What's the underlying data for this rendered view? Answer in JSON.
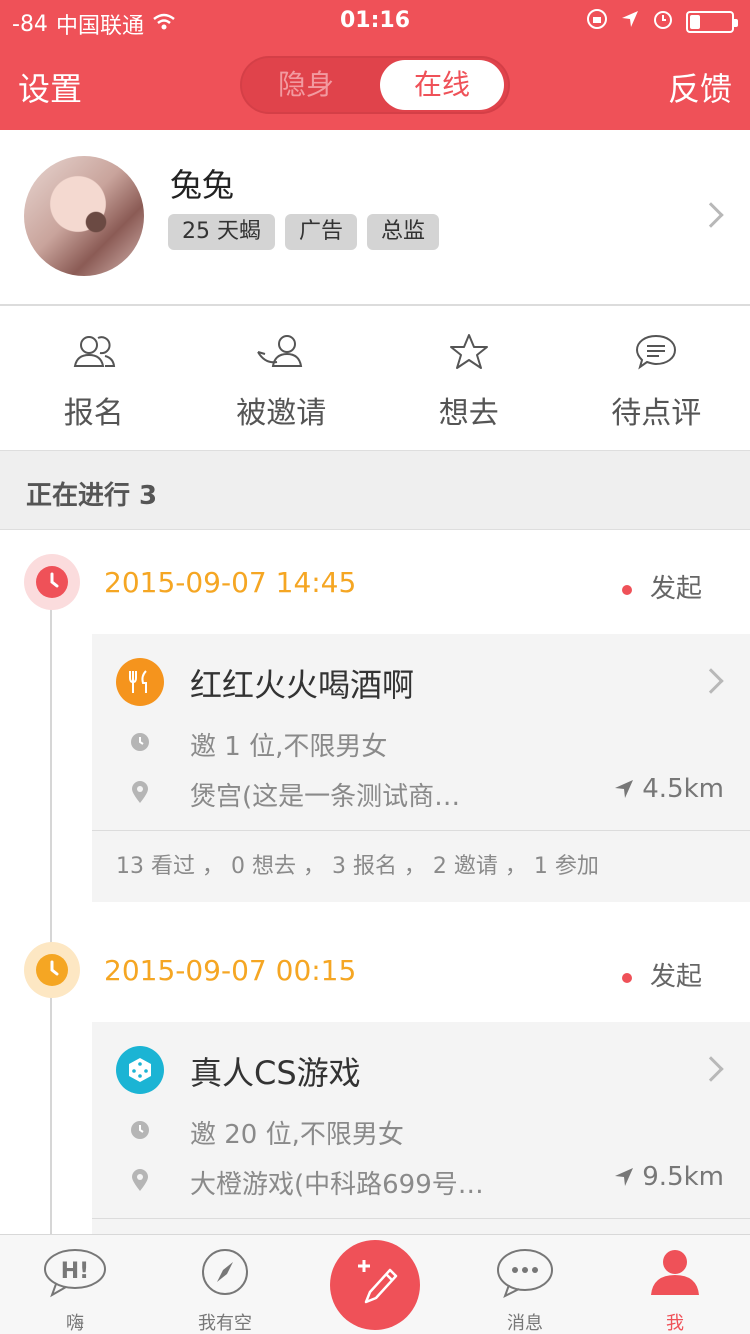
{
  "status_bar": {
    "signal": "-84",
    "carrier": "中国联通",
    "time": "01:16"
  },
  "header": {
    "left_label": "设置",
    "right_label": "反馈",
    "toggle_options": [
      "隐身",
      "在线"
    ],
    "toggle_selected": "在线"
  },
  "profile": {
    "name": "兔兔",
    "tags": [
      "25 天蝎",
      "广告",
      "总监"
    ]
  },
  "actions": [
    {
      "label": "报名",
      "icon": "users-icon"
    },
    {
      "label": "被邀请",
      "icon": "invited-icon"
    },
    {
      "label": "想去",
      "icon": "star-icon"
    },
    {
      "label": "待点评",
      "icon": "comment-icon"
    }
  ],
  "section": {
    "title": "正在进行 3"
  },
  "timeline": [
    {
      "date": "2015-09-07 14:45",
      "status": "发起",
      "dot_color": "#ef5158",
      "title": "红红火火喝酒啊",
      "category_icon": "food-icon",
      "invite": "邀 1 位,不限男女",
      "location": "煲宫(这是一条测试商…",
      "distance": "4.5km",
      "stats": "13 看过 ， 0 想去 ， 3 报名 ， 2 邀请 ， 1 参加"
    },
    {
      "date": "2015-09-07 00:15",
      "status": "发起",
      "dot_color": "#f5a623",
      "title": "真人CS游戏",
      "category_icon": "dice-icon",
      "invite": "邀 20 位,不限男女",
      "location": "大橙游戏(中科路699号…",
      "distance": "9.5km"
    }
  ],
  "tabbar": [
    {
      "label": "嗨",
      "icon": "hi-bubble-icon"
    },
    {
      "label": "我有空",
      "icon": "compass-icon"
    },
    {
      "label": "消息",
      "icon": "message-icon"
    },
    {
      "label": "我",
      "icon": "person-icon"
    }
  ],
  "colors": {
    "brand": "#ef5158",
    "date": "#f5a623"
  },
  "battery_level": 0.25
}
